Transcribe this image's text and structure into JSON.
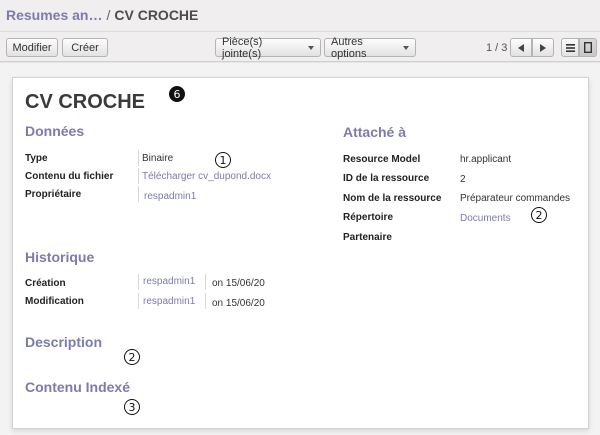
{
  "breadcrumb": {
    "parent": "Resumes an…",
    "separator": "/",
    "current": "CV CROCHE"
  },
  "toolbar": {
    "edit_label": "Modifier",
    "create_label": "Créer",
    "attachments_label": "Pièce(s) jointe(s)",
    "more_label": "Autres options",
    "pager": "1 / 3"
  },
  "record": {
    "title": "CV CROCHE"
  },
  "sections": {
    "data_title": "Données",
    "attached_title": "Attaché à",
    "history_title": "Historique",
    "description_title": "Description",
    "indexed_title": "Contenu Indexé"
  },
  "data_fields": {
    "type_label": "Type",
    "type_value": "Binaire",
    "file_label": "Contenu du fichier",
    "file_value": "Télécharger cv_dupond.docx",
    "owner_label": "Propriétaire",
    "owner_value": "respadmin1"
  },
  "attached_fields": {
    "model_label": "Resource Model",
    "model_value": "hr.applicant",
    "res_id_label": "ID de la ressource",
    "res_id_value": "2",
    "res_name_label": "Nom de la ressource",
    "res_name_value": "Préparateur commandes",
    "directory_label": "Répertoire",
    "directory_value": "Documents",
    "partner_label": "Partenaire"
  },
  "history_fields": {
    "created_label": "Création",
    "created_user": "respadmin1",
    "created_date": "on 15/06/20",
    "modified_label": "Modification",
    "modified_user": "respadmin1",
    "modified_date": "on 15/06/20"
  },
  "annotations": {
    "title_marker": "6",
    "type_marker": "1",
    "directory_marker": "2",
    "description_marker": "2",
    "indexed_marker": "3"
  },
  "colors": {
    "accent": "#7c7bad",
    "title": "#3a3a3a"
  }
}
